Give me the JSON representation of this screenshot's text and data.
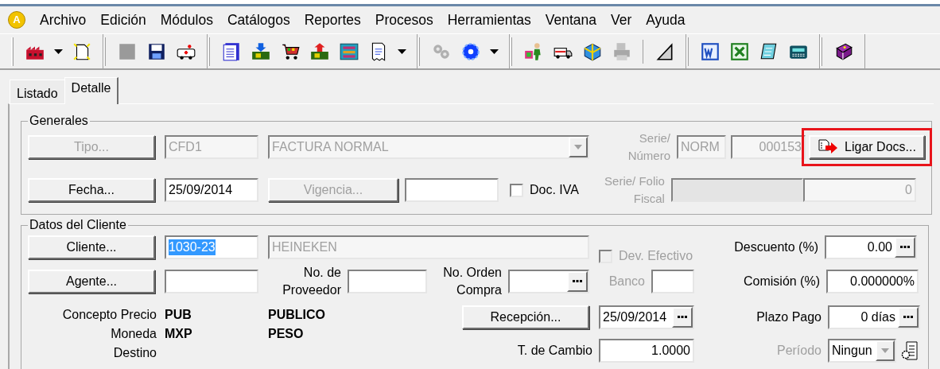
{
  "app_logo": "A",
  "menu": [
    "Archivo",
    "Edición",
    "Módulos",
    "Catálogos",
    "Reportes",
    "Procesos",
    "Herramientas",
    "Ventana",
    "Ver",
    "Ayuda"
  ],
  "tabs": [
    {
      "label": "Listado",
      "selected": false
    },
    {
      "label": "Detalle",
      "selected": true
    }
  ],
  "generales": {
    "title": "Generales",
    "tipo_button": {
      "label": "Tipo...",
      "disabled": true
    },
    "tipo_code": {
      "value": "CFD1",
      "disabled": true
    },
    "tipo_name": {
      "value": "FACTURA NORMAL",
      "disabled": true
    },
    "serie_numero_label": {
      "lines": [
        "Serie/",
        "Número"
      ],
      "disabled": true
    },
    "serie": {
      "value": "NORM",
      "disabled": true
    },
    "numero": {
      "value": "000153",
      "disabled": true
    },
    "ligar_button": {
      "label": "Ligar Docs...",
      "highlighted": true
    },
    "fecha_button": {
      "label": "Fecha...",
      "disabled": false
    },
    "fecha": {
      "value": "25/09/2014",
      "disabled": false
    },
    "vigencia_button": {
      "label": "Vigencia...",
      "disabled": true
    },
    "doc_iva": {
      "label": "Doc. IVA",
      "checked": false,
      "disabled": false
    },
    "serie_folio_label": {
      "lines": [
        "Serie/ Folio",
        "Fiscal"
      ],
      "disabled": true
    },
    "folio_fiscal": {
      "disabled": true
    },
    "folio_count": {
      "value": "0",
      "disabled": true
    }
  },
  "datos_cliente": {
    "title": "Datos del Cliente",
    "cliente_button": {
      "label": "Cliente...",
      "disabled": false
    },
    "cliente_code": {
      "value": "1030-23",
      "text_selected": true
    },
    "cliente_name": {
      "value": "HEINEKEN",
      "disabled": true
    },
    "dev_efectivo": {
      "label": "Dev. Efectivo",
      "checked": false,
      "disabled": true
    },
    "descuento": {
      "label": "Descuento (%)",
      "value": "0.00"
    },
    "agente_button": {
      "label": "Agente...",
      "disabled": false
    },
    "proveedor": {
      "lines": [
        "No. de",
        "Proveedor"
      ]
    },
    "orden_compra": {
      "lines": [
        "No. Orden",
        "Compra"
      ]
    },
    "banco": {
      "label": "Banco",
      "disabled": true
    },
    "comision": {
      "label": "Comisión (%)",
      "value": "0.000000%"
    },
    "concepto_rows": [
      {
        "label": "Concepto Precio",
        "code": "PUB",
        "name": "PUBLICO"
      },
      {
        "label": "Moneda",
        "code": "MXP",
        "name": "PESO"
      },
      {
        "label": "Destino"
      }
    ],
    "recepcion_button": {
      "label": "Recepción...",
      "disabled": false
    },
    "recepcion_fecha": {
      "value": "25/09/2014"
    },
    "plazo_pago": {
      "label": "Plazo Pago",
      "value": "0 días"
    },
    "tipo_cambio": {
      "label": "T. de Cambio",
      "value": "1.0000"
    },
    "periodo": {
      "label": "Período",
      "value": "Ningun",
      "disabled": true
    }
  }
}
